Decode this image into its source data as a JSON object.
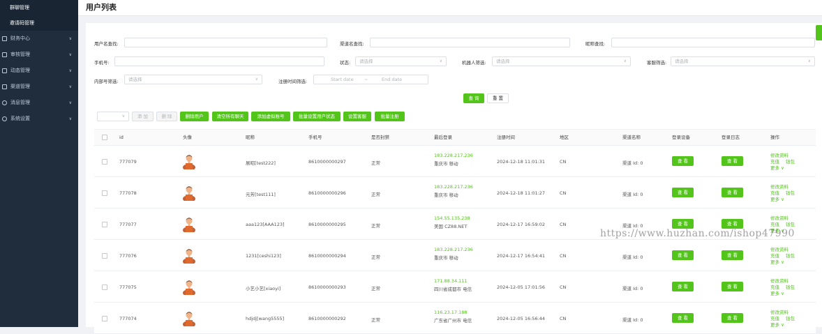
{
  "sidebar": {
    "sub_items": [
      "群聊管理",
      "邀请码管理"
    ],
    "items": [
      {
        "label": "财务中心"
      },
      {
        "label": "审核管理"
      },
      {
        "label": "动态管理"
      },
      {
        "label": "渠道管理"
      },
      {
        "label": "消息管理"
      },
      {
        "label": "系统设置"
      }
    ]
  },
  "page": {
    "title": "用户列表"
  },
  "filters": {
    "username_label": "用户名查找:",
    "channel_label": "渠道名查找:",
    "nickname_label": "昵称查找:",
    "phone_label": "手机号:",
    "status_label": "状态:",
    "status_placeholder": "请选择",
    "robot_label": "机器人筛选:",
    "robot_placeholder": "请选择",
    "service_label": "客服筛选:",
    "service_placeholder": "请选择",
    "internal_label": "内部号筛选:",
    "internal_placeholder": "请选择",
    "regtime_label": "注册时间筛选:",
    "start_placeholder": "Start date",
    "range_sep": "~",
    "end_placeholder": "End date",
    "search_button": "查 询",
    "reset_button": "重 置"
  },
  "toolbar": {
    "add_label": "添 加",
    "delete_label": "删 除",
    "buttons": [
      "删除用户",
      "清空所有聊天",
      "添加虚拟账号",
      "批量设置用户状态",
      "设置客服",
      "批量注册"
    ]
  },
  "table": {
    "headers": [
      "id",
      "头像",
      "昵称",
      "手机号",
      "是否封禁",
      "最后登录",
      "注册时间",
      "地区",
      "渠道名称",
      "登录设备",
      "登录日志",
      "操作"
    ],
    "view_label": "查 看",
    "op_edit": "修改资料",
    "op_recharge": "充值",
    "op_wallet": "钱包",
    "op_more": "更多",
    "rows": [
      {
        "id": "777079",
        "nickname": "展昭[test222]",
        "phone": "8610000000297",
        "banned": "正常",
        "ip": "183.228.217.236",
        "location": "重庆市 移动",
        "regtime": "2024-12-18 11:01:31",
        "region": "CN",
        "channel": "渠道 Id:  0"
      },
      {
        "id": "777078",
        "nickname": "元芳[test111]",
        "phone": "8610000000296",
        "banned": "正常",
        "ip": "183.228.217.236",
        "location": "重庆市 移动",
        "regtime": "2024-12-18 11:01:27",
        "region": "CN",
        "channel": "渠道 Id:  0"
      },
      {
        "id": "777077",
        "nickname": "aaa123[AAA123]",
        "phone": "8610000000295",
        "banned": "正常",
        "ip": "154.55.135.238",
        "location": "美国 CZ88.NET",
        "regtime": "2024-12-17 16:59:02",
        "region": "CN",
        "channel": "渠道 Id:  0"
      },
      {
        "id": "777076",
        "nickname": "1231[ceshi123]",
        "phone": "8610000000294",
        "banned": "正常",
        "ip": "183.228.217.236",
        "location": "重庆市 移动",
        "regtime": "2024-12-17 16:54:41",
        "region": "CN",
        "channel": "渠道 Id:  0"
      },
      {
        "id": "777075",
        "nickname": "小艺小艺[xiaoyi]",
        "phone": "8610000000293",
        "banned": "正常",
        "ip": "171.88.34.111",
        "location": "四川省成都市 电信",
        "regtime": "2024-12-05 17:01:56",
        "region": "CN",
        "channel": "渠道 Id:  0"
      },
      {
        "id": "777074",
        "nickname": "hdjdj[wang5555]",
        "phone": "8610000000292",
        "banned": "正常",
        "ip": "116.23.17.188",
        "location": "广东省广州市 电信",
        "regtime": "2024-12-05 16:56:44",
        "region": "CN",
        "channel": "渠道 Id:  0"
      }
    ]
  },
  "watermark": "https://www.huzhan.com/ishop47990",
  "colors": {
    "accent": "#52c41a",
    "sidebar_bg": "#1f2d3d",
    "link": "#52c41a"
  }
}
